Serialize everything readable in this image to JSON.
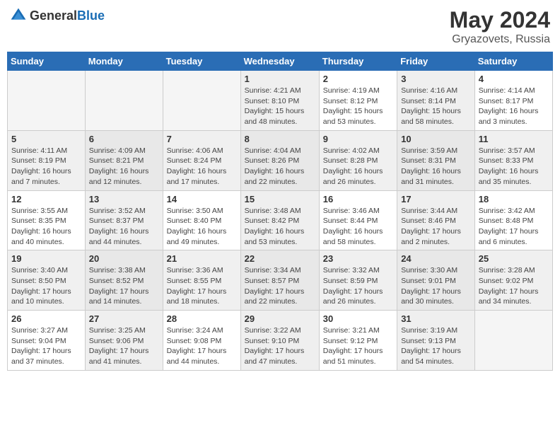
{
  "header": {
    "logo_general": "General",
    "logo_blue": "Blue",
    "title": "May 2024",
    "subtitle": "Gryazovets, Russia"
  },
  "weekdays": [
    "Sunday",
    "Monday",
    "Tuesday",
    "Wednesday",
    "Thursday",
    "Friday",
    "Saturday"
  ],
  "weeks": [
    [
      {
        "day": "",
        "info": ""
      },
      {
        "day": "",
        "info": ""
      },
      {
        "day": "",
        "info": ""
      },
      {
        "day": "1",
        "info": "Sunrise: 4:21 AM\nSunset: 8:10 PM\nDaylight: 15 hours and 48 minutes."
      },
      {
        "day": "2",
        "info": "Sunrise: 4:19 AM\nSunset: 8:12 PM\nDaylight: 15 hours and 53 minutes."
      },
      {
        "day": "3",
        "info": "Sunrise: 4:16 AM\nSunset: 8:14 PM\nDaylight: 15 hours and 58 minutes."
      },
      {
        "day": "4",
        "info": "Sunrise: 4:14 AM\nSunset: 8:17 PM\nDaylight: 16 hours and 3 minutes."
      }
    ],
    [
      {
        "day": "5",
        "info": "Sunrise: 4:11 AM\nSunset: 8:19 PM\nDaylight: 16 hours and 7 minutes."
      },
      {
        "day": "6",
        "info": "Sunrise: 4:09 AM\nSunset: 8:21 PM\nDaylight: 16 hours and 12 minutes."
      },
      {
        "day": "7",
        "info": "Sunrise: 4:06 AM\nSunset: 8:24 PM\nDaylight: 16 hours and 17 minutes."
      },
      {
        "day": "8",
        "info": "Sunrise: 4:04 AM\nSunset: 8:26 PM\nDaylight: 16 hours and 22 minutes."
      },
      {
        "day": "9",
        "info": "Sunrise: 4:02 AM\nSunset: 8:28 PM\nDaylight: 16 hours and 26 minutes."
      },
      {
        "day": "10",
        "info": "Sunrise: 3:59 AM\nSunset: 8:31 PM\nDaylight: 16 hours and 31 minutes."
      },
      {
        "day": "11",
        "info": "Sunrise: 3:57 AM\nSunset: 8:33 PM\nDaylight: 16 hours and 35 minutes."
      }
    ],
    [
      {
        "day": "12",
        "info": "Sunrise: 3:55 AM\nSunset: 8:35 PM\nDaylight: 16 hours and 40 minutes."
      },
      {
        "day": "13",
        "info": "Sunrise: 3:52 AM\nSunset: 8:37 PM\nDaylight: 16 hours and 44 minutes."
      },
      {
        "day": "14",
        "info": "Sunrise: 3:50 AM\nSunset: 8:40 PM\nDaylight: 16 hours and 49 minutes."
      },
      {
        "day": "15",
        "info": "Sunrise: 3:48 AM\nSunset: 8:42 PM\nDaylight: 16 hours and 53 minutes."
      },
      {
        "day": "16",
        "info": "Sunrise: 3:46 AM\nSunset: 8:44 PM\nDaylight: 16 hours and 58 minutes."
      },
      {
        "day": "17",
        "info": "Sunrise: 3:44 AM\nSunset: 8:46 PM\nDaylight: 17 hours and 2 minutes."
      },
      {
        "day": "18",
        "info": "Sunrise: 3:42 AM\nSunset: 8:48 PM\nDaylight: 17 hours and 6 minutes."
      }
    ],
    [
      {
        "day": "19",
        "info": "Sunrise: 3:40 AM\nSunset: 8:50 PM\nDaylight: 17 hours and 10 minutes."
      },
      {
        "day": "20",
        "info": "Sunrise: 3:38 AM\nSunset: 8:52 PM\nDaylight: 17 hours and 14 minutes."
      },
      {
        "day": "21",
        "info": "Sunrise: 3:36 AM\nSunset: 8:55 PM\nDaylight: 17 hours and 18 minutes."
      },
      {
        "day": "22",
        "info": "Sunrise: 3:34 AM\nSunset: 8:57 PM\nDaylight: 17 hours and 22 minutes."
      },
      {
        "day": "23",
        "info": "Sunrise: 3:32 AM\nSunset: 8:59 PM\nDaylight: 17 hours and 26 minutes."
      },
      {
        "day": "24",
        "info": "Sunrise: 3:30 AM\nSunset: 9:01 PM\nDaylight: 17 hours and 30 minutes."
      },
      {
        "day": "25",
        "info": "Sunrise: 3:28 AM\nSunset: 9:02 PM\nDaylight: 17 hours and 34 minutes."
      }
    ],
    [
      {
        "day": "26",
        "info": "Sunrise: 3:27 AM\nSunset: 9:04 PM\nDaylight: 17 hours and 37 minutes."
      },
      {
        "day": "27",
        "info": "Sunrise: 3:25 AM\nSunset: 9:06 PM\nDaylight: 17 hours and 41 minutes."
      },
      {
        "day": "28",
        "info": "Sunrise: 3:24 AM\nSunset: 9:08 PM\nDaylight: 17 hours and 44 minutes."
      },
      {
        "day": "29",
        "info": "Sunrise: 3:22 AM\nSunset: 9:10 PM\nDaylight: 17 hours and 47 minutes."
      },
      {
        "day": "30",
        "info": "Sunrise: 3:21 AM\nSunset: 9:12 PM\nDaylight: 17 hours and 51 minutes."
      },
      {
        "day": "31",
        "info": "Sunrise: 3:19 AM\nSunset: 9:13 PM\nDaylight: 17 hours and 54 minutes."
      },
      {
        "day": "",
        "info": ""
      }
    ]
  ]
}
